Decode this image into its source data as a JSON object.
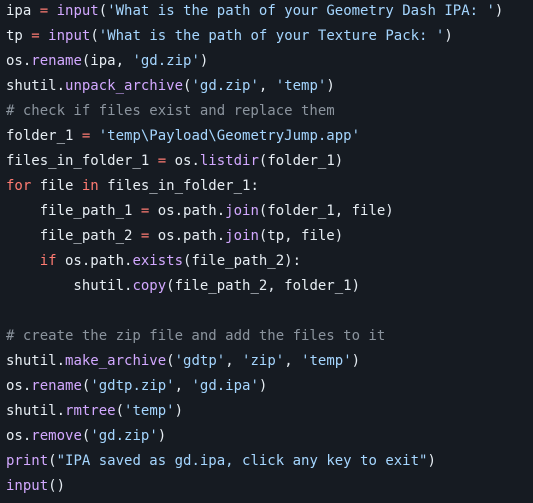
{
  "colors": {
    "background": "#161b22",
    "text": "#e6edf3",
    "function": "#d2a8ff",
    "string": "#a5d6ff",
    "keyword": "#ff7b72",
    "operator": "#ff7b72",
    "comment": "#8b949e"
  },
  "code": {
    "lines": [
      [
        {
          "t": "text",
          "v": "ipa "
        },
        {
          "t": "op",
          "v": "="
        },
        {
          "t": "text",
          "v": " "
        },
        {
          "t": "fn",
          "v": "input"
        },
        {
          "t": "text",
          "v": "("
        },
        {
          "t": "str",
          "v": "'What is the path of your Geometry Dash IPA: '"
        },
        {
          "t": "text",
          "v": ")"
        }
      ],
      [
        {
          "t": "text",
          "v": "tp "
        },
        {
          "t": "op",
          "v": "="
        },
        {
          "t": "text",
          "v": " "
        },
        {
          "t": "fn",
          "v": "input"
        },
        {
          "t": "text",
          "v": "("
        },
        {
          "t": "str",
          "v": "'What is the path of your Texture Pack: '"
        },
        {
          "t": "text",
          "v": ")"
        }
      ],
      [
        {
          "t": "text",
          "v": "os."
        },
        {
          "t": "fn",
          "v": "rename"
        },
        {
          "t": "text",
          "v": "(ipa, "
        },
        {
          "t": "str",
          "v": "'gd.zip'"
        },
        {
          "t": "text",
          "v": ")"
        }
      ],
      [
        {
          "t": "text",
          "v": "shutil."
        },
        {
          "t": "fn",
          "v": "unpack_archive"
        },
        {
          "t": "text",
          "v": "("
        },
        {
          "t": "str",
          "v": "'gd.zip'"
        },
        {
          "t": "text",
          "v": ", "
        },
        {
          "t": "str",
          "v": "'temp'"
        },
        {
          "t": "text",
          "v": ")"
        }
      ],
      [
        {
          "t": "cm",
          "v": "# check if files exist and replace them"
        }
      ],
      [
        {
          "t": "text",
          "v": "folder_1 "
        },
        {
          "t": "op",
          "v": "="
        },
        {
          "t": "text",
          "v": " "
        },
        {
          "t": "str",
          "v": "'temp\\Payload\\GeometryJump.app'"
        }
      ],
      [
        {
          "t": "text",
          "v": "files_in_folder_1 "
        },
        {
          "t": "op",
          "v": "="
        },
        {
          "t": "text",
          "v": " os."
        },
        {
          "t": "fn",
          "v": "listdir"
        },
        {
          "t": "text",
          "v": "(folder_1)"
        }
      ],
      [
        {
          "t": "kw",
          "v": "for"
        },
        {
          "t": "text",
          "v": " file "
        },
        {
          "t": "kw",
          "v": "in"
        },
        {
          "t": "text",
          "v": " files_in_folder_1:"
        }
      ],
      [
        {
          "t": "text",
          "v": "    file_path_1 "
        },
        {
          "t": "op",
          "v": "="
        },
        {
          "t": "text",
          "v": " os.path."
        },
        {
          "t": "fn",
          "v": "join"
        },
        {
          "t": "text",
          "v": "(folder_1, file)"
        }
      ],
      [
        {
          "t": "text",
          "v": "    file_path_2 "
        },
        {
          "t": "op",
          "v": "="
        },
        {
          "t": "text",
          "v": " os.path."
        },
        {
          "t": "fn",
          "v": "join"
        },
        {
          "t": "text",
          "v": "(tp, file)"
        }
      ],
      [
        {
          "t": "text",
          "v": "    "
        },
        {
          "t": "kw",
          "v": "if"
        },
        {
          "t": "text",
          "v": " os.path."
        },
        {
          "t": "fn",
          "v": "exists"
        },
        {
          "t": "text",
          "v": "(file_path_2):"
        }
      ],
      [
        {
          "t": "text",
          "v": "        shutil."
        },
        {
          "t": "fn",
          "v": "copy"
        },
        {
          "t": "text",
          "v": "(file_path_2, folder_1)"
        }
      ],
      [],
      [
        {
          "t": "cm",
          "v": "# create the zip file and add the files to it"
        }
      ],
      [
        {
          "t": "text",
          "v": "shutil."
        },
        {
          "t": "fn",
          "v": "make_archive"
        },
        {
          "t": "text",
          "v": "("
        },
        {
          "t": "str",
          "v": "'gdtp'"
        },
        {
          "t": "text",
          "v": ", "
        },
        {
          "t": "str",
          "v": "'zip'"
        },
        {
          "t": "text",
          "v": ", "
        },
        {
          "t": "str",
          "v": "'temp'"
        },
        {
          "t": "text",
          "v": ")"
        }
      ],
      [
        {
          "t": "text",
          "v": "os."
        },
        {
          "t": "fn",
          "v": "rename"
        },
        {
          "t": "text",
          "v": "("
        },
        {
          "t": "str",
          "v": "'gdtp.zip'"
        },
        {
          "t": "text",
          "v": ", "
        },
        {
          "t": "str",
          "v": "'gd.ipa'"
        },
        {
          "t": "text",
          "v": ")"
        }
      ],
      [
        {
          "t": "text",
          "v": "shutil."
        },
        {
          "t": "fn",
          "v": "rmtree"
        },
        {
          "t": "text",
          "v": "("
        },
        {
          "t": "str",
          "v": "'temp'"
        },
        {
          "t": "text",
          "v": ")"
        }
      ],
      [
        {
          "t": "text",
          "v": "os."
        },
        {
          "t": "fn",
          "v": "remove"
        },
        {
          "t": "text",
          "v": "("
        },
        {
          "t": "str",
          "v": "'gd.zip'"
        },
        {
          "t": "text",
          "v": ")"
        }
      ],
      [
        {
          "t": "fn",
          "v": "print"
        },
        {
          "t": "text",
          "v": "("
        },
        {
          "t": "str",
          "v": "\"IPA saved as gd.ipa, click any key to exit\""
        },
        {
          "t": "text",
          "v": ")"
        }
      ],
      [
        {
          "t": "fn",
          "v": "input"
        },
        {
          "t": "text",
          "v": "()"
        }
      ]
    ]
  }
}
